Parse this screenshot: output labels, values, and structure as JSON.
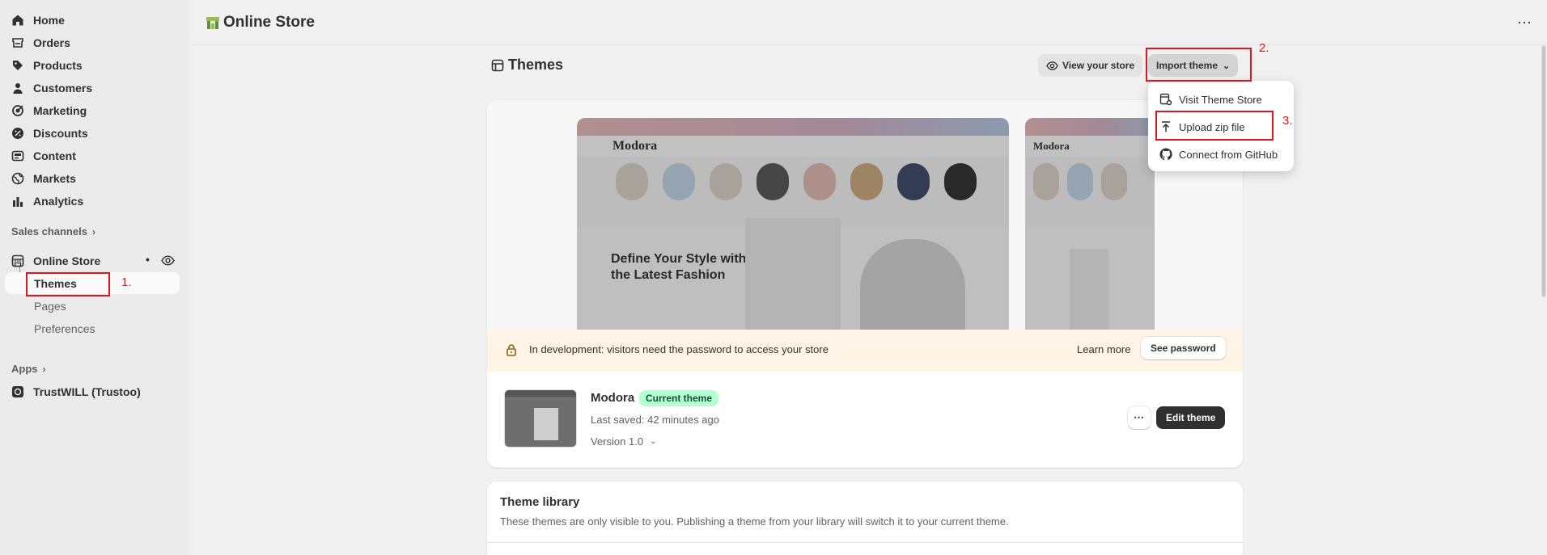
{
  "sidebar": {
    "nav": [
      {
        "label": "Home",
        "icon": "home-icon"
      },
      {
        "label": "Orders",
        "icon": "orders-icon"
      },
      {
        "label": "Products",
        "icon": "tag-icon"
      },
      {
        "label": "Customers",
        "icon": "person-icon"
      },
      {
        "label": "Marketing",
        "icon": "target-icon"
      },
      {
        "label": "Discounts",
        "icon": "discount-icon"
      },
      {
        "label": "Content",
        "icon": "content-icon"
      },
      {
        "label": "Markets",
        "icon": "globe-icon"
      },
      {
        "label": "Analytics",
        "icon": "bar-chart-icon"
      }
    ],
    "sales_channels_label": "Sales channels",
    "online_store_label": "Online Store",
    "sub_items": [
      "Themes",
      "Pages",
      "Preferences"
    ],
    "apps_label": "Apps",
    "app_item": "TrustWILL (Trustoo)"
  },
  "topbar": {
    "title": "Online Store"
  },
  "header": {
    "title": "Themes",
    "view_store_label": "View your store",
    "import_label": "Import theme"
  },
  "dropdown": {
    "items": [
      {
        "label": "Visit Theme Store",
        "icon": "theme-store-icon"
      },
      {
        "label": "Upload zip file",
        "icon": "upload-icon"
      },
      {
        "label": "Connect from GitHub",
        "icon": "github-icon"
      }
    ]
  },
  "annotations": [
    "1.",
    "2.",
    "3."
  ],
  "preview": {
    "brand": "Modora",
    "hero_text": "Define Your Style with the Latest Fashion"
  },
  "banner": {
    "message": "In development: visitors need the password to access your store",
    "learn_more": "Learn more",
    "see_password": "See password"
  },
  "current_theme": {
    "name": "Modora",
    "badge": "Current theme",
    "last_saved": "Last saved: 42 minutes ago",
    "version": "Version 1.0",
    "edit_label": "Edit theme"
  },
  "library": {
    "title": "Theme library",
    "description": "These themes are only visible to you. Publishing a theme from your library will switch it to your current theme."
  },
  "colors": {
    "annotation_red": "#e0141e",
    "badge_green": "#b4fed2",
    "banner_bg": "#fff4e5",
    "primary_button": "#303030"
  }
}
